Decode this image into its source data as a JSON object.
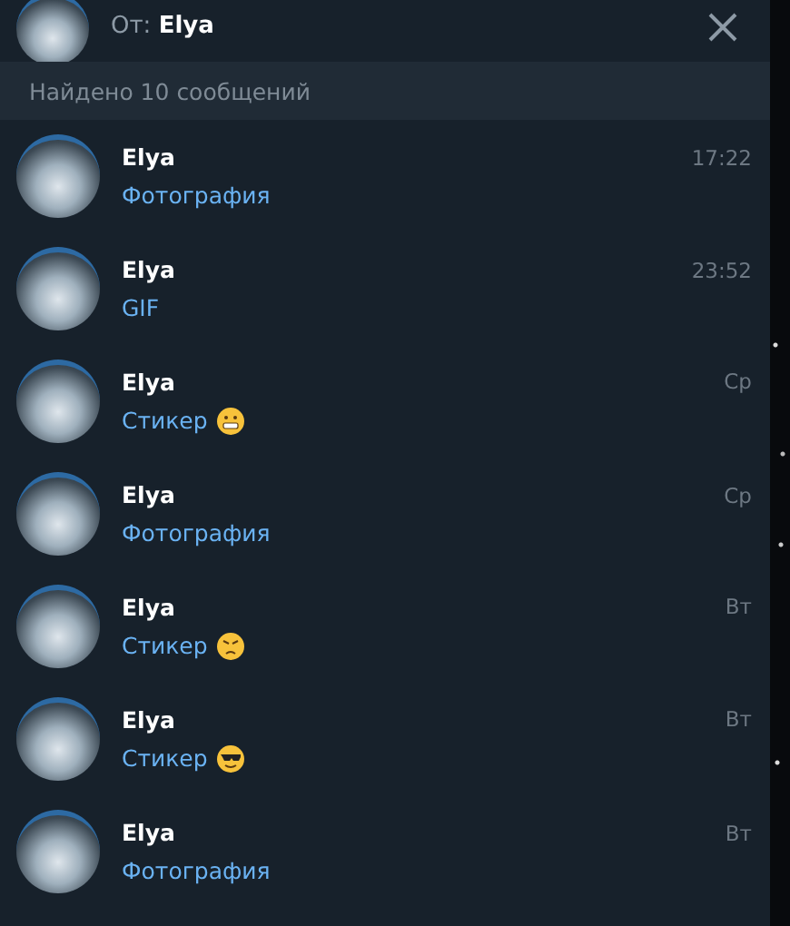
{
  "header": {
    "from_label": "От:",
    "from_name": "Elya"
  },
  "results_caption": "Найдено 10 сообщений",
  "messages": [
    {
      "name": "Elya",
      "preview": "Фотография",
      "time": "17:22",
      "kind": "plain"
    },
    {
      "name": "Elya",
      "preview": "GIF",
      "time": "23:52",
      "kind": "plain"
    },
    {
      "name": "Elya",
      "preview": "Стикер",
      "time": "Ср",
      "kind": "grimace"
    },
    {
      "name": "Elya",
      "preview": "Фотография",
      "time": "Ср",
      "kind": "plain"
    },
    {
      "name": "Elya",
      "preview": "Стикер",
      "time": "Вт",
      "kind": "angry"
    },
    {
      "name": "Elya",
      "preview": "Стикер",
      "time": "Вт",
      "kind": "sunglasses"
    },
    {
      "name": "Elya",
      "preview": "Фотография",
      "time": "Вт",
      "kind": "plain"
    }
  ]
}
